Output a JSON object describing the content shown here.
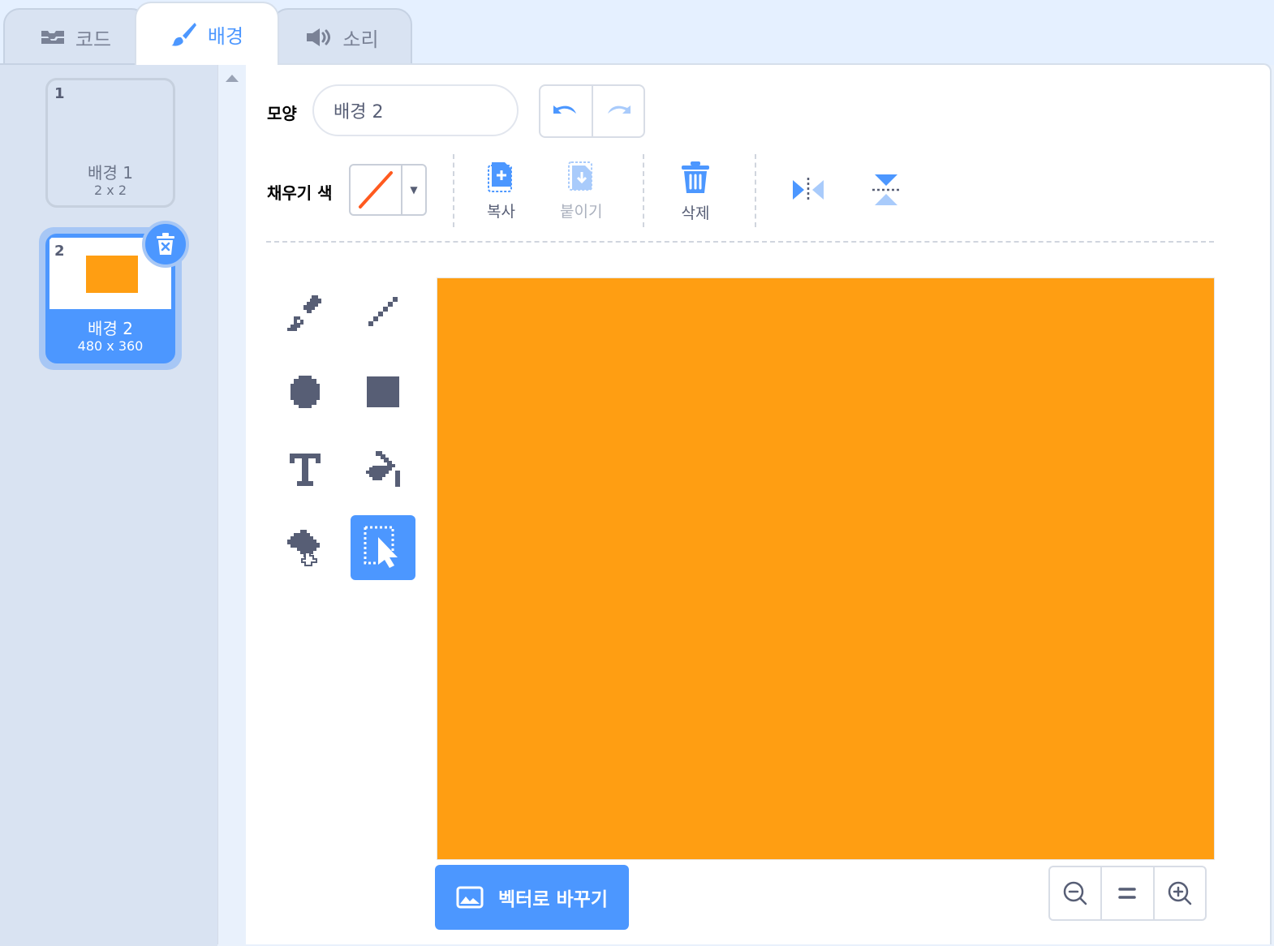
{
  "tabs": [
    {
      "label": "코드",
      "icon": "code-icon"
    },
    {
      "label": "배경",
      "icon": "brush-icon"
    },
    {
      "label": "소리",
      "icon": "speaker-icon"
    }
  ],
  "costumes": [
    {
      "number": "1",
      "name": "배경 1",
      "size": "2 x 2"
    },
    {
      "number": "2",
      "name": "배경 2",
      "size": "480 x 360",
      "thumbnail_color": "#ff9e12"
    }
  ],
  "editor": {
    "name_label": "모양",
    "costume_name": "배경 2",
    "fill_label": "채우기 색",
    "copy_label": "복사",
    "paste_label": "붙이기",
    "delete_label": "삭제",
    "convert_label": "벡터로 바꾸기"
  },
  "colors": {
    "accent": "#4c97ff",
    "canvas_fill": "#ff9e12",
    "fill_swatch_slash": "#ff5a1f",
    "tool_icon": "#575e75"
  }
}
